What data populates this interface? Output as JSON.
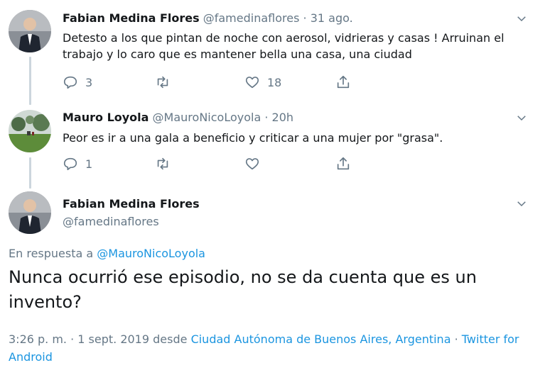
{
  "tweets": [
    {
      "name": "Fabian Medina Flores",
      "handle": "@famedinaflores",
      "separator": "·",
      "time": "31 ago.",
      "text": "Detesto a los que pintan de noche con aerosol, vidrieras y casas ! Arruinan el trabajo y lo caro que es mantener bella una casa, una ciudad",
      "replies": "3",
      "retweets": "",
      "likes": "18"
    },
    {
      "name": "Mauro Loyola",
      "handle": "@MauroNicoLoyola",
      "separator": "·",
      "time": "20h",
      "text": "Peor es ir a una gala a beneficio y criticar a una mujer por \"grasa\".",
      "replies": "1",
      "retweets": "",
      "likes": ""
    }
  ],
  "main": {
    "name": "Fabian Medina Flores",
    "handle": "@famedinaflores",
    "reply_prefix": "En respuesta a",
    "reply_handle": "@MauroNicoLoyola",
    "text": "Nunca ocurrió ese episodio, no se da cuenta que es un invento?",
    "timestamp": "3:26 p. m. · 1 sept. 2019 desde",
    "location": "Ciudad Autónoma de Buenos Aires, Argentina",
    "via_separator": "·",
    "source": "Twitter for Android"
  },
  "icons": {
    "reply": "reply-icon",
    "retweet": "retweet-icon",
    "like": "heart-icon",
    "share": "share-icon",
    "menu": "chevron-down-icon"
  },
  "colors": {
    "link": "#1b95e0",
    "secondary": "#657786",
    "thread_line": "#ccd6dd"
  }
}
